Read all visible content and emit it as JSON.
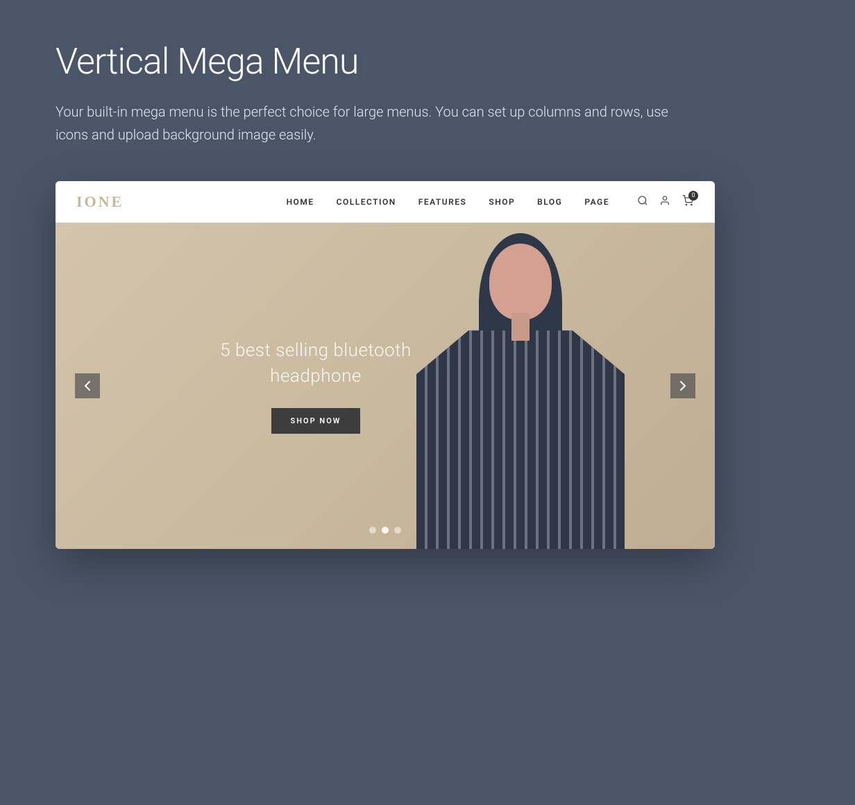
{
  "page": {
    "title": "Vertical Mega Menu",
    "description": "Your built-in mega menu is the perfect choice for large menus. You can set up columns and rows, use icons and upload background image easily."
  },
  "navbar": {
    "logo": "IONE",
    "links": [
      {
        "label": "HOME"
      },
      {
        "label": "COLLECTION"
      },
      {
        "label": "FEATURES"
      },
      {
        "label": "SHOP"
      },
      {
        "label": "BLOG"
      },
      {
        "label": "PAGE"
      }
    ],
    "cart_count": "0"
  },
  "hero": {
    "title_line1": "5 best selling bluetooth",
    "title_line2": "headphone",
    "button_label": "SHOP NOW"
  },
  "dots": [
    {
      "active": false
    },
    {
      "active": true
    },
    {
      "active": false
    }
  ],
  "icons": {
    "search": "🔍",
    "user": "👤",
    "cart": "🛒",
    "arrow_left": "‹",
    "arrow_right": "›"
  }
}
